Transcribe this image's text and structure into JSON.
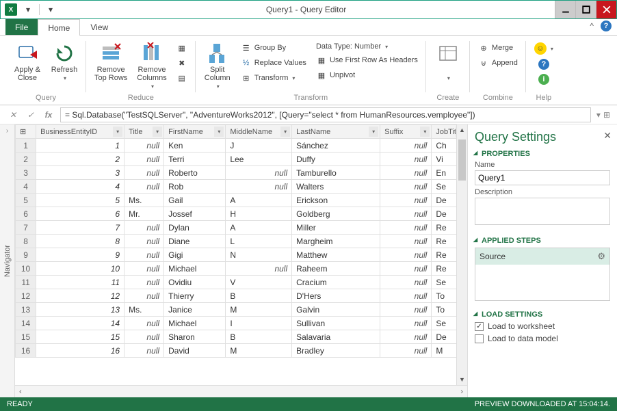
{
  "title": "Query1 - Query Editor",
  "tabs": {
    "file": "File",
    "home": "Home",
    "view": "View"
  },
  "ribbon": {
    "query": {
      "apply_close": "Apply &\nClose",
      "refresh": "Refresh",
      "label": "Query"
    },
    "reduce": {
      "remove_top": "Remove\nTop Rows",
      "remove_cols": "Remove\nColumns",
      "label": "Reduce"
    },
    "split": {
      "split": "Split\nColumn",
      "groupby": "Group By",
      "replace": "Replace Values",
      "transform": "Transform",
      "datatype": "Data Type: Number",
      "firstrow": "Use First Row As Headers",
      "unpivot": "Unpivot",
      "label": "Transform"
    },
    "create": {
      "label": "Create"
    },
    "combine": {
      "merge": "Merge",
      "append": "Append",
      "label": "Combine"
    },
    "help": {
      "label": "Help"
    }
  },
  "formula": "= Sql.Database(\"TestSQLServer\", \"AdventureWorks2012\", [Query=\"select * from HumanResources.vemployee\"])",
  "navigator_label": "Navigator",
  "columns": [
    "BusinessEntityID",
    "Title",
    "FirstName",
    "MiddleName",
    "LastName",
    "Suffix",
    "JobTit"
  ],
  "rows": [
    {
      "n": 1,
      "id": "1",
      "title": "null",
      "first": "Ken",
      "mid": "J",
      "last": "Sánchez",
      "suf": "null",
      "job": "Ch"
    },
    {
      "n": 2,
      "id": "2",
      "title": "null",
      "first": "Terri",
      "mid": "Lee",
      "last": "Duffy",
      "suf": "null",
      "job": "Vi"
    },
    {
      "n": 3,
      "id": "3",
      "title": "null",
      "first": "Roberto",
      "mid": "null",
      "last": "Tamburello",
      "suf": "null",
      "job": "En"
    },
    {
      "n": 4,
      "id": "4",
      "title": "null",
      "first": "Rob",
      "mid": "null",
      "last": "Walters",
      "suf": "null",
      "job": "Se"
    },
    {
      "n": 5,
      "id": "5",
      "title": "Ms.",
      "first": "Gail",
      "mid": "A",
      "last": "Erickson",
      "suf": "null",
      "job": "De"
    },
    {
      "n": 6,
      "id": "6",
      "title": "Mr.",
      "first": "Jossef",
      "mid": "H",
      "last": "Goldberg",
      "suf": "null",
      "job": "De"
    },
    {
      "n": 7,
      "id": "7",
      "title": "null",
      "first": "Dylan",
      "mid": "A",
      "last": "Miller",
      "suf": "null",
      "job": "Re"
    },
    {
      "n": 8,
      "id": "8",
      "title": "null",
      "first": "Diane",
      "mid": "L",
      "last": "Margheim",
      "suf": "null",
      "job": "Re"
    },
    {
      "n": 9,
      "id": "9",
      "title": "null",
      "first": "Gigi",
      "mid": "N",
      "last": "Matthew",
      "suf": "null",
      "job": "Re"
    },
    {
      "n": 10,
      "id": "10",
      "title": "null",
      "first": "Michael",
      "mid": "null",
      "last": "Raheem",
      "suf": "null",
      "job": "Re"
    },
    {
      "n": 11,
      "id": "11",
      "title": "null",
      "first": "Ovidiu",
      "mid": "V",
      "last": "Cracium",
      "suf": "null",
      "job": "Se"
    },
    {
      "n": 12,
      "id": "12",
      "title": "null",
      "first": "Thierry",
      "mid": "B",
      "last": "D'Hers",
      "suf": "null",
      "job": "To"
    },
    {
      "n": 13,
      "id": "13",
      "title": "Ms.",
      "first": "Janice",
      "mid": "M",
      "last": "Galvin",
      "suf": "null",
      "job": "To"
    },
    {
      "n": 14,
      "id": "14",
      "title": "null",
      "first": "Michael",
      "mid": "I",
      "last": "Sullivan",
      "suf": "null",
      "job": "Se"
    },
    {
      "n": 15,
      "id": "15",
      "title": "null",
      "first": "Sharon",
      "mid": "B",
      "last": "Salavaria",
      "suf": "null",
      "job": "De"
    },
    {
      "n": 16,
      "id": "16",
      "title": "null",
      "first": "David",
      "mid": "M",
      "last": "Bradley",
      "suf": "null",
      "job": "M"
    }
  ],
  "settings": {
    "title": "Query Settings",
    "properties": "PROPERTIES",
    "name_label": "Name",
    "name_value": "Query1",
    "desc_label": "Description",
    "applied_steps": "APPLIED STEPS",
    "step_source": "Source",
    "load_settings": "LOAD SETTINGS",
    "load_worksheet": "Load to worksheet",
    "load_datamodel": "Load to data model"
  },
  "status": {
    "ready": "READY",
    "preview": "PREVIEW DOWNLOADED AT 15:04:14."
  }
}
